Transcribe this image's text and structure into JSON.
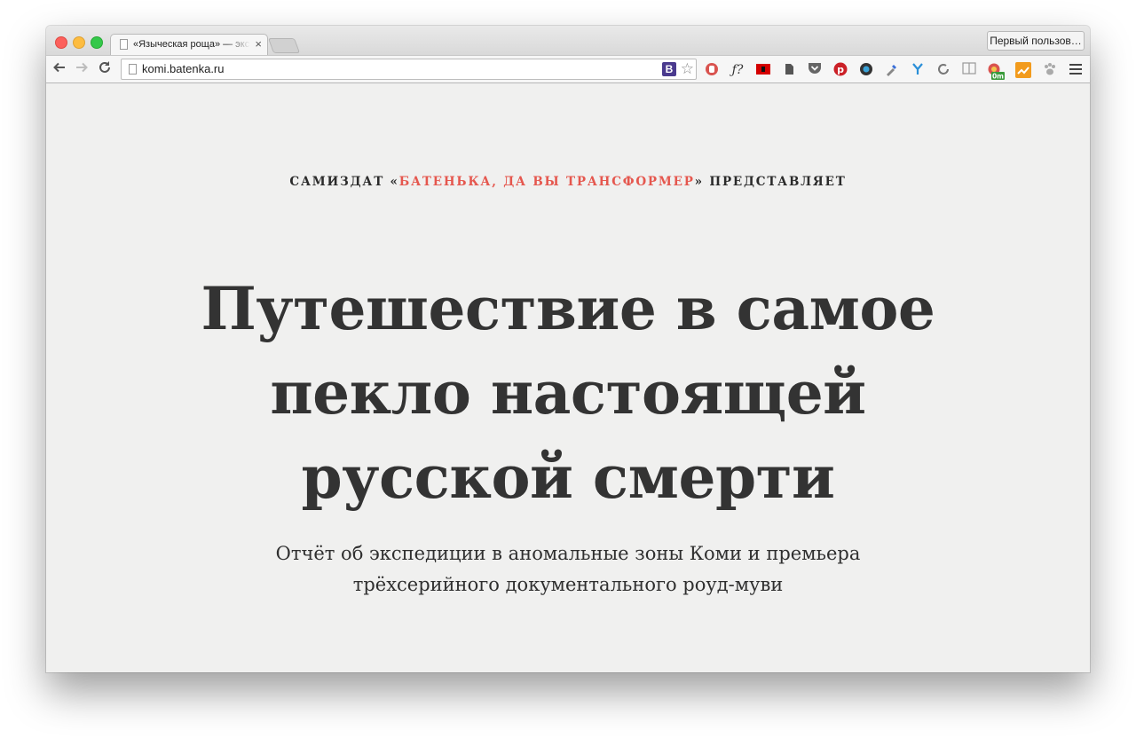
{
  "browser": {
    "tab": {
      "title": "«Языческая роща» — экс"
    },
    "profile_button": "Первый пользов…",
    "address": {
      "url": "komi.batenka.ru"
    },
    "b_icon_label": "B",
    "extension_icons": [
      "hand-icon",
      "f-question-icon",
      "flag-icon",
      "evernote-icon",
      "pocket-icon",
      "pinterest-icon",
      "lens-icon",
      "eyedropper-icon",
      "y-icon",
      "reload-ext-icon",
      "reader-icon",
      "badge-icon",
      "analytics-icon",
      "paw-icon"
    ],
    "badge_label": "0m"
  },
  "page": {
    "presents": {
      "prefix": "САМИЗДАТ «",
      "link": "БАТЕНЬКА, ДА ВЫ ТРАНСФОРМЕР",
      "suffix": "» ПРЕДСТАВЛЯЕТ"
    },
    "headline": {
      "line1": "Путешествие в самое",
      "line2": "пекло настоящей",
      "line3": "русской смерти"
    },
    "subtitle": {
      "line1": "Отчёт об экспедиции в аномальные зоны Коми и премьера",
      "line2": "трёхсерийного документального роуд-муви"
    },
    "colors": {
      "accent": "#e5574e",
      "background": "#f0f0ef",
      "text": "#333333"
    }
  }
}
